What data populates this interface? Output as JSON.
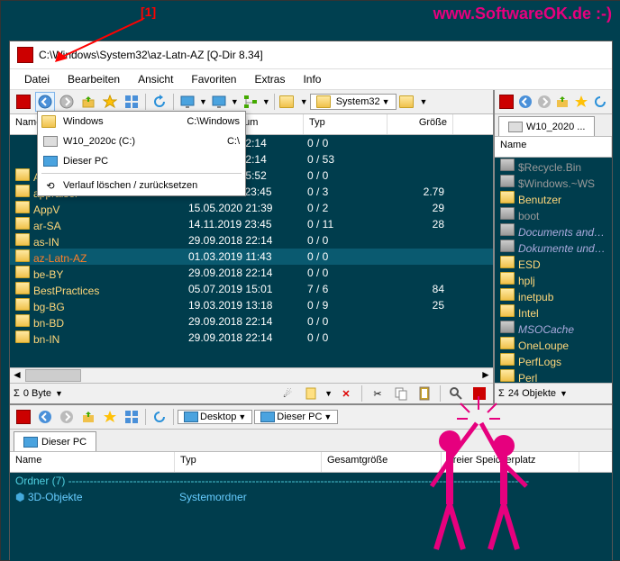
{
  "watermark": "www.SoftwareOK.de :-)",
  "annotation": "[1]",
  "window": {
    "title": "C:\\Windows\\System32\\az-Latn-AZ  [Q-Dir 8.34]"
  },
  "menu": [
    "Datei",
    "Bearbeiten",
    "Ansicht",
    "Favoriten",
    "Extras",
    "Info"
  ],
  "crumb_left": "System32",
  "tab_right": "W10_2020 ...",
  "left_cols": [
    "Name",
    "nderungsdatum",
    "Typ",
    "Größe"
  ],
  "right_cols": [
    "Name"
  ],
  "dropdown": {
    "items": [
      {
        "icon": "folder",
        "label": "Windows",
        "path": "C:\\Windows"
      },
      {
        "icon": "drive",
        "label": "W10_2020c (C:)",
        "path": "C:\\"
      },
      {
        "icon": "monitor",
        "label": "Dieser PC",
        "path": ""
      }
    ],
    "reset": "Verlauf löschen / zurücksetzen"
  },
  "left_rows": [
    {
      "name": "AppLocker",
      "date": "19.03.2019 5:52",
      "type": "0 / 0",
      "size": ""
    },
    {
      "name": "appraiser",
      "date": "14.11.2019 23:45",
      "type": "0 / 3",
      "size": "2.79"
    },
    {
      "name": "AppV",
      "date": "15.05.2020 21:39",
      "type": "0 / 2",
      "size": "29"
    },
    {
      "name": "ar-SA",
      "date": "14.11.2019 23:45",
      "type": "0 / 11",
      "size": "28"
    },
    {
      "name": "as-IN",
      "date": "29.09.2018 22:14",
      "type": "0 / 0",
      "size": ""
    },
    {
      "name": "az-Latn-AZ",
      "date": "01.03.2019 11:43",
      "type": "0 / 0",
      "size": "",
      "sel": true
    },
    {
      "name": "be-BY",
      "date": "29.09.2018 22:14",
      "type": "0 / 0",
      "size": ""
    },
    {
      "name": "BestPractices",
      "date": "05.07.2019 15:01",
      "type": "7 / 6",
      "size": "84"
    },
    {
      "name": "bg-BG",
      "date": "19.03.2019 13:18",
      "type": "0 / 9",
      "size": "25"
    },
    {
      "name": "bn-BD",
      "date": "29.09.2018 22:14",
      "type": "0 / 0",
      "size": ""
    },
    {
      "name": "bn-IN",
      "date": "29.09.2018 22:14",
      "type": "0 / 0",
      "size": ""
    }
  ],
  "hidden_dates": [
    "0.09.2018 22:14",
    "0.09.2018 22:14"
  ],
  "hidden_types": [
    "0 / 0",
    "0 / 53"
  ],
  "right_rows": [
    {
      "name": "$Recycle.Bin",
      "style": "hidden-f"
    },
    {
      "name": "$Windows.~WS",
      "style": "hidden-f"
    },
    {
      "name": "Benutzer",
      "style": ""
    },
    {
      "name": "boot",
      "style": "hidden-f"
    },
    {
      "name": "Documents and Set",
      "style": "italic"
    },
    {
      "name": "Dokumente und Ein",
      "style": "italic"
    },
    {
      "name": "ESD",
      "style": ""
    },
    {
      "name": "hplj",
      "style": ""
    },
    {
      "name": "inetpub",
      "style": ""
    },
    {
      "name": "Intel",
      "style": ""
    },
    {
      "name": "MSOCache",
      "style": "italic"
    },
    {
      "name": "OneLoupe",
      "style": ""
    },
    {
      "name": "PerfLogs",
      "style": ""
    },
    {
      "name": "Perl",
      "style": ""
    }
  ],
  "status_left": "0 Byte",
  "status_right": "24 Objekte",
  "lower": {
    "crumbs": [
      "Desktop",
      "Dieser PC"
    ],
    "tab": "Dieser PC",
    "cols": [
      "Name",
      "Typ",
      "Gesamtgröße",
      "Freier Speicherplatz"
    ],
    "divider": "Ordner (7) --------------------------------------------------------------------------------------------------------------------------------",
    "rows": [
      {
        "name": "3D-Objekte",
        "type": "Systemordner"
      }
    ]
  }
}
